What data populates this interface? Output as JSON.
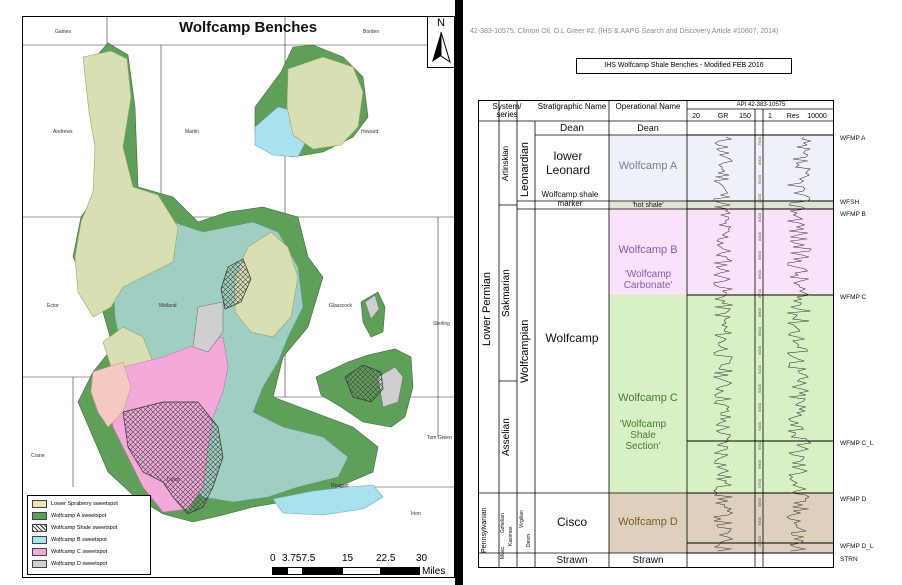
{
  "map": {
    "title": "Wolfcamp Benches",
    "north_label": "N",
    "counties": [
      "Gaines",
      "Borden",
      "Andrews",
      "Martin",
      "Howard",
      "Ector",
      "Midland",
      "Glasscock",
      "Sterling",
      "Tom Green",
      "Crane",
      "Upton",
      "Reagan",
      "Irion"
    ],
    "legend": [
      {
        "label": "Lower Spraberry sweetspot",
        "color": "#f2dfb6",
        "pattern": "solid"
      },
      {
        "label": "Wolfcamp A sweetspot",
        "color": "#5f9f5a",
        "pattern": "solid"
      },
      {
        "label": "Wolfcamp Shale sweetspot",
        "color": "#ffffff",
        "pattern": "crosshatch"
      },
      {
        "label": "Wolfcamp B sweetspot",
        "color": "#a9e1ef",
        "pattern": "solid"
      },
      {
        "label": "Wolfcamp C sweetspot",
        "color": "#f3a9d9",
        "pattern": "solid"
      },
      {
        "label": "Wolfcamp D sweetspot",
        "color": "#cfcfcf",
        "pattern": "solid"
      }
    ],
    "scale_labels": [
      "0",
      "3.757.5",
      "15",
      "22.5",
      "30"
    ],
    "scale_unit": "Miles"
  },
  "log": {
    "citation": "42-383-10575. Clinton Oil, O.L Greer #2. (IHS & AAPG Search and Discovery Article #10607, 2014)",
    "title": "IHS Wolfcamp Shale Benches - Modified FEB 2016",
    "headers": {
      "system": "System/ series",
      "strat": "Stratigraphic Name",
      "oper": "Operational Name",
      "api": "API 42-383-10575",
      "gr": "GR",
      "gr_min": "20",
      "gr_max": "150",
      "res": "Res",
      "res_min": "1",
      "res_max": "10000"
    },
    "system": "Lower Permian",
    "pennsylvanian": "Pennsylvanian",
    "stages": [
      "Artinskian",
      "Sakmarian",
      "Asselian"
    ],
    "series": [
      "Leonardian",
      "Wolfcampian"
    ],
    "penn_stages": [
      "Gzhelian",
      "Kasimov.",
      "Mosc."
    ],
    "penn_series": [
      "Virgilian",
      "Desm."
    ],
    "strat_names": [
      "Dean",
      "lower Leonard",
      "Wolfcamp shale marker",
      "Wolfcamp",
      "Cisco",
      "Strawn"
    ],
    "oper_names": [
      "Dean",
      "Wolfcamp A",
      "'hot shale'",
      "Wolfcamp B",
      "'Wolfcamp Carbonate'",
      "Wolfcamp C",
      "'Wolfcamp Shale Section'",
      "Wolfcamp D",
      "Strawn"
    ],
    "markers": [
      "WFMP A",
      "WFSH",
      "WFMP B",
      "WFMP C",
      "WFMP C_L",
      "WFMP D",
      "WFMP D_L",
      "STRN"
    ],
    "depths": [
      "7900",
      "8000",
      "8100",
      "8200",
      "8300",
      "8400",
      "8500",
      "8600",
      "8700",
      "8800",
      "8900",
      "9000",
      "9100",
      "9200",
      "9300",
      "9400",
      "9500",
      "9600",
      "9700",
      "9800",
      "9900",
      "10000"
    ],
    "colors": {
      "wolfcamp_a": "#eef1f7",
      "wolfcamp_b": "#fbe2fb",
      "wolfcamp_c": "#d7f0c4",
      "wolfcamp_d": "#ddd1bd",
      "hot_shale": "#dfe5d3"
    }
  }
}
